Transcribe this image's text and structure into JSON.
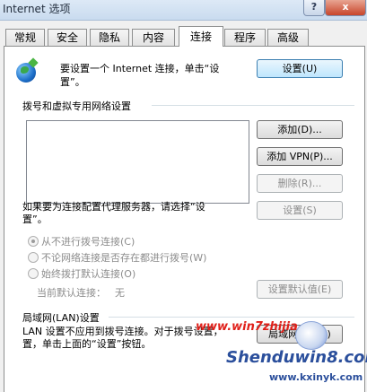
{
  "window": {
    "title": "Internet 选项",
    "help_label": "?",
    "close_label": "x"
  },
  "tabs": [
    {
      "label": "常规"
    },
    {
      "label": "安全"
    },
    {
      "label": "隐私"
    },
    {
      "label": "内容"
    },
    {
      "label": "连接",
      "active": true
    },
    {
      "label": "程序"
    },
    {
      "label": "高级"
    }
  ],
  "setup": {
    "text_line1": "要设置一个 Internet 连接，单击“设",
    "text_line2": "置”。",
    "button": "设置(U)"
  },
  "dialup": {
    "heading": "拨号和虚拟专用网络设置",
    "add_button": "添加(D)...",
    "add_vpn_button": "添加 VPN(P)...",
    "remove_button": "删除(R)...",
    "proxy_text_line1": "如果要为连接配置代理服务器，请选择“设",
    "proxy_text_line2": "置”。",
    "settings_button": "设置(S)",
    "radio_never": "从不进行拨号连接(C)",
    "radio_when_no_network": "不论网络连接是否存在都进行拨号(W)",
    "radio_always": "始终拨打默认连接(O)",
    "current_default_label": "当前默认连接：",
    "current_default_value": "无",
    "set_default_button": "设置默认值(E)"
  },
  "lan": {
    "heading": "局域网(LAN)设置",
    "text_line1": "LAN 设置不应用到拨号连接。对于拨号设置，",
    "text_line2": "置，单击上面的“设置”按钮。",
    "button": "局域网设置(L)"
  },
  "watermark": {
    "site1": "www.win7zhijia.cn",
    "site2": "Shenduwin8.com",
    "site3": "www.kxinyk.com"
  },
  "colors": {
    "accent": "#3c7fb1",
    "watermark_red": "#e0201a",
    "watermark_blue": "#2b4f9c"
  }
}
